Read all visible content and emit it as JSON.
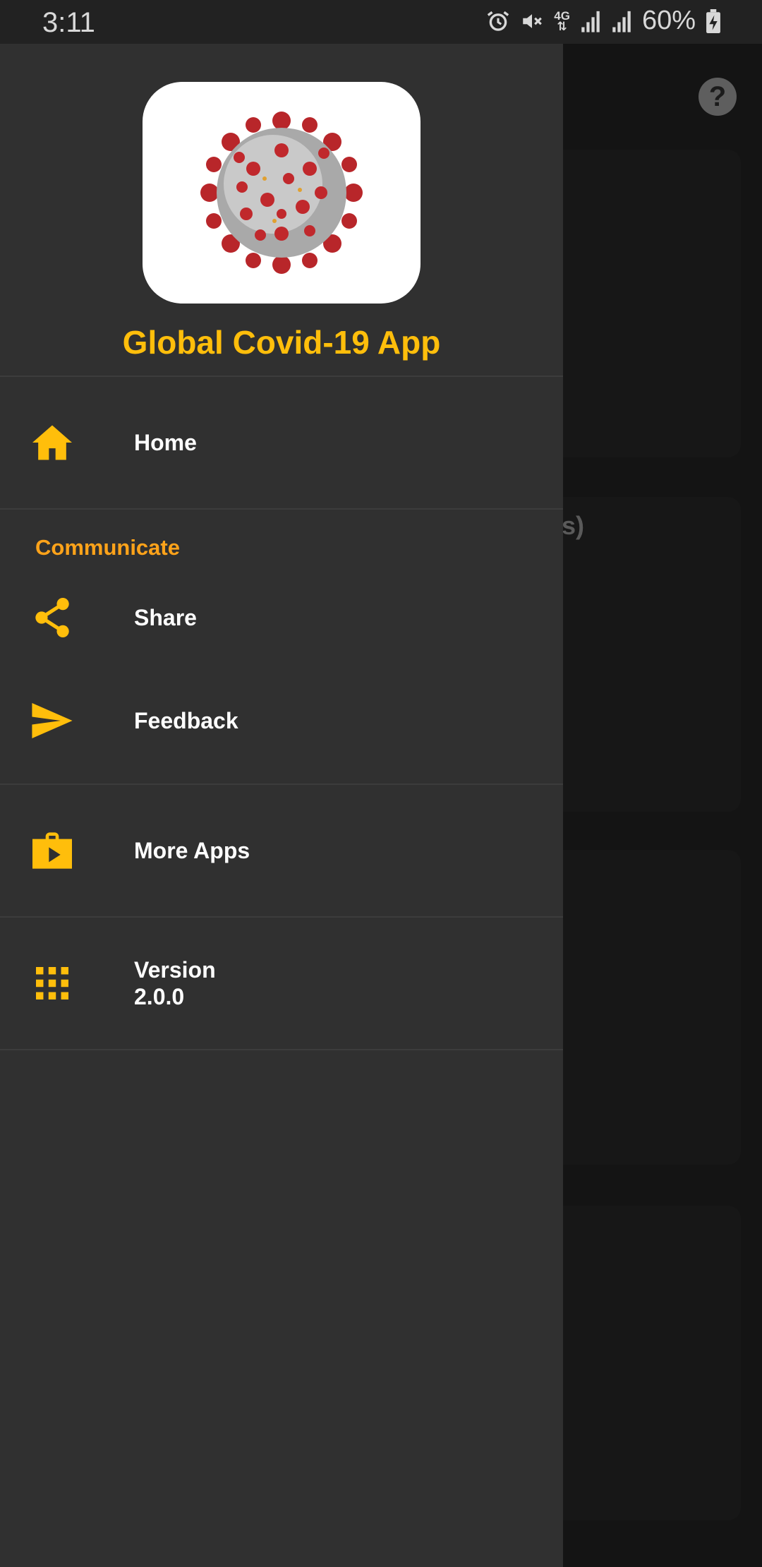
{
  "status_bar": {
    "time": "3:11",
    "network": "4G",
    "battery": "60%"
  },
  "background": {
    "partial_text": "s)",
    "help_icon": "?"
  },
  "drawer": {
    "app_title": "Global Covid-19 App",
    "logo_icon": "coronavirus-illustration",
    "items": [
      {
        "label": "Home",
        "icon": "home-icon"
      }
    ],
    "communicate": {
      "header": "Communicate",
      "items": [
        {
          "label": "Share",
          "icon": "share-icon"
        },
        {
          "label": "Feedback",
          "icon": "send-icon"
        }
      ]
    },
    "more_apps": {
      "label": "More Apps",
      "icon": "store-icon"
    },
    "version": {
      "label": "Version",
      "value": "2.0.0",
      "icon": "apps-grid-icon"
    }
  },
  "colors": {
    "accent": "#ffbe0b",
    "section_header": "#ffa31a",
    "drawer_bg": "#303030",
    "text": "#ffffff"
  }
}
